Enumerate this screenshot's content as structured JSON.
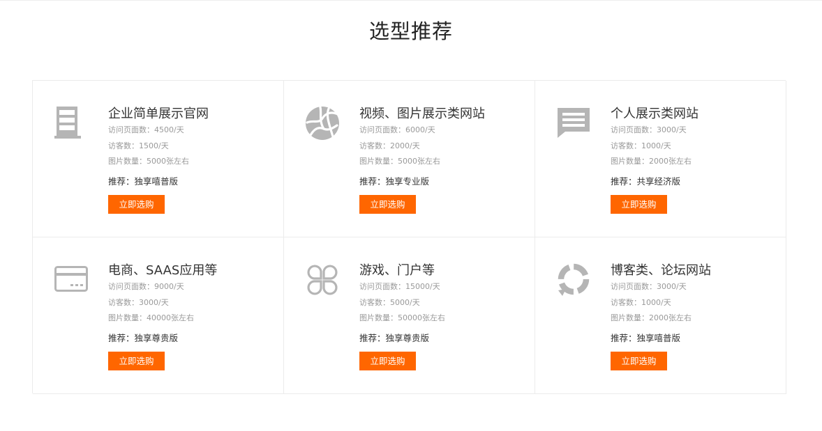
{
  "page": {
    "title": "选型推荐"
  },
  "colors": {
    "accent": "#ff6600",
    "icon": "#b5b5b5",
    "border": "#ebebeb"
  },
  "cards": [
    {
      "icon": "server-icon",
      "title": "企业简单展示官网",
      "pv": "访问页面数：4500/天",
      "visitors": "访客数：1500/天",
      "images": "图片数量：5000张左右",
      "recommend": "推荐：独享嘻普版",
      "button": "立即选购"
    },
    {
      "icon": "media-icon",
      "title": "视频、图片展示类网站",
      "pv": "访问页面数：6000/天",
      "visitors": "访客数：2000/天",
      "images": "图片数量：5000张左右",
      "recommend": "推荐：独享专业版",
      "button": "立即选购"
    },
    {
      "icon": "chat-bubble-icon",
      "title": "个人展示类网站",
      "pv": "访问页面数：3000/天",
      "visitors": "访客数：1000/天",
      "images": "图片数量：2000张左右",
      "recommend": "推荐：共享经济版",
      "button": "立即选购"
    },
    {
      "icon": "credit-card-icon",
      "title": "电商、SAAS应用等",
      "pv": "访问页面数：9000/天",
      "visitors": "访客数：3000/天",
      "images": "图片数量：40000张左右",
      "recommend": "推荐：独享尊贵版",
      "button": "立即选购"
    },
    {
      "icon": "clover-icon",
      "title": "游戏、门户等",
      "pv": "访问页面数：15000/天",
      "visitors": "访客数：5000/天",
      "images": "图片数量：50000张左右",
      "recommend": "推荐：独享尊贵版",
      "button": "立即选购"
    },
    {
      "icon": "forum-ring-icon",
      "title": "博客类、论坛网站",
      "pv": "访问页面数：3000/天",
      "visitors": "访客数：1000/天",
      "images": "图片数量：2000张左右",
      "recommend": "推荐：独享嘻普版",
      "button": "立即选购"
    }
  ]
}
